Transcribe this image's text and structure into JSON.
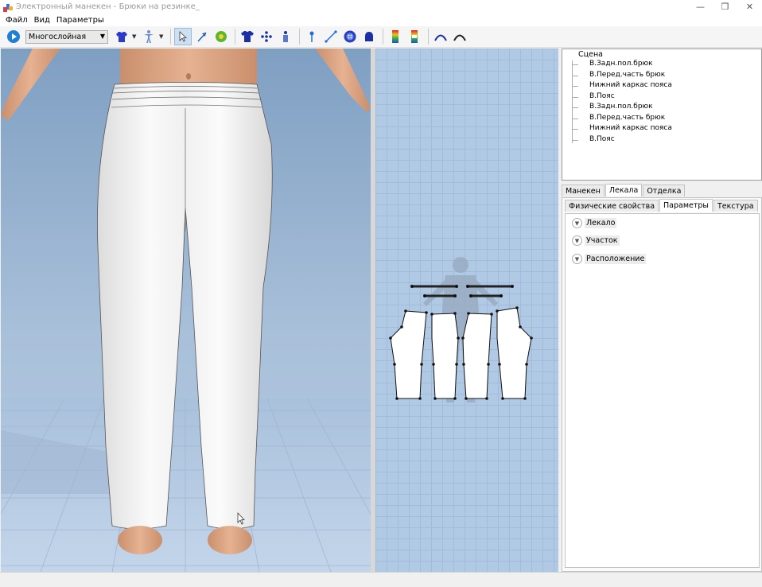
{
  "window": {
    "title": "Электронный манекен - Брюки на резинке_",
    "minimize": "—",
    "restore": "❐",
    "close": "✕"
  },
  "menu": [
    "Файл",
    "Вид",
    "Параметры"
  ],
  "toolbar": {
    "mode_combo": "Многослойная"
  },
  "tree": {
    "root": "Сцена",
    "items": [
      "В.Задн.пол.брюк",
      "В.Перед.часть брюк",
      "Нижний каркас пояса",
      "В.Пояс",
      "В.Задн.пол.брюк",
      "В.Перед.часть брюк",
      "Нижний каркас пояса",
      "В.Пояс"
    ]
  },
  "tabs_main": [
    {
      "label": "Манекен",
      "selected": false
    },
    {
      "label": "Лекала",
      "selected": true
    },
    {
      "label": "Отделка",
      "selected": false
    }
  ],
  "tabs_sub": [
    {
      "label": "Физические свойства",
      "selected": false
    },
    {
      "label": "Параметры",
      "selected": true
    },
    {
      "label": "Текстура",
      "selected": false
    }
  ],
  "props": [
    "Лекало",
    "Участок",
    "Расположение"
  ]
}
